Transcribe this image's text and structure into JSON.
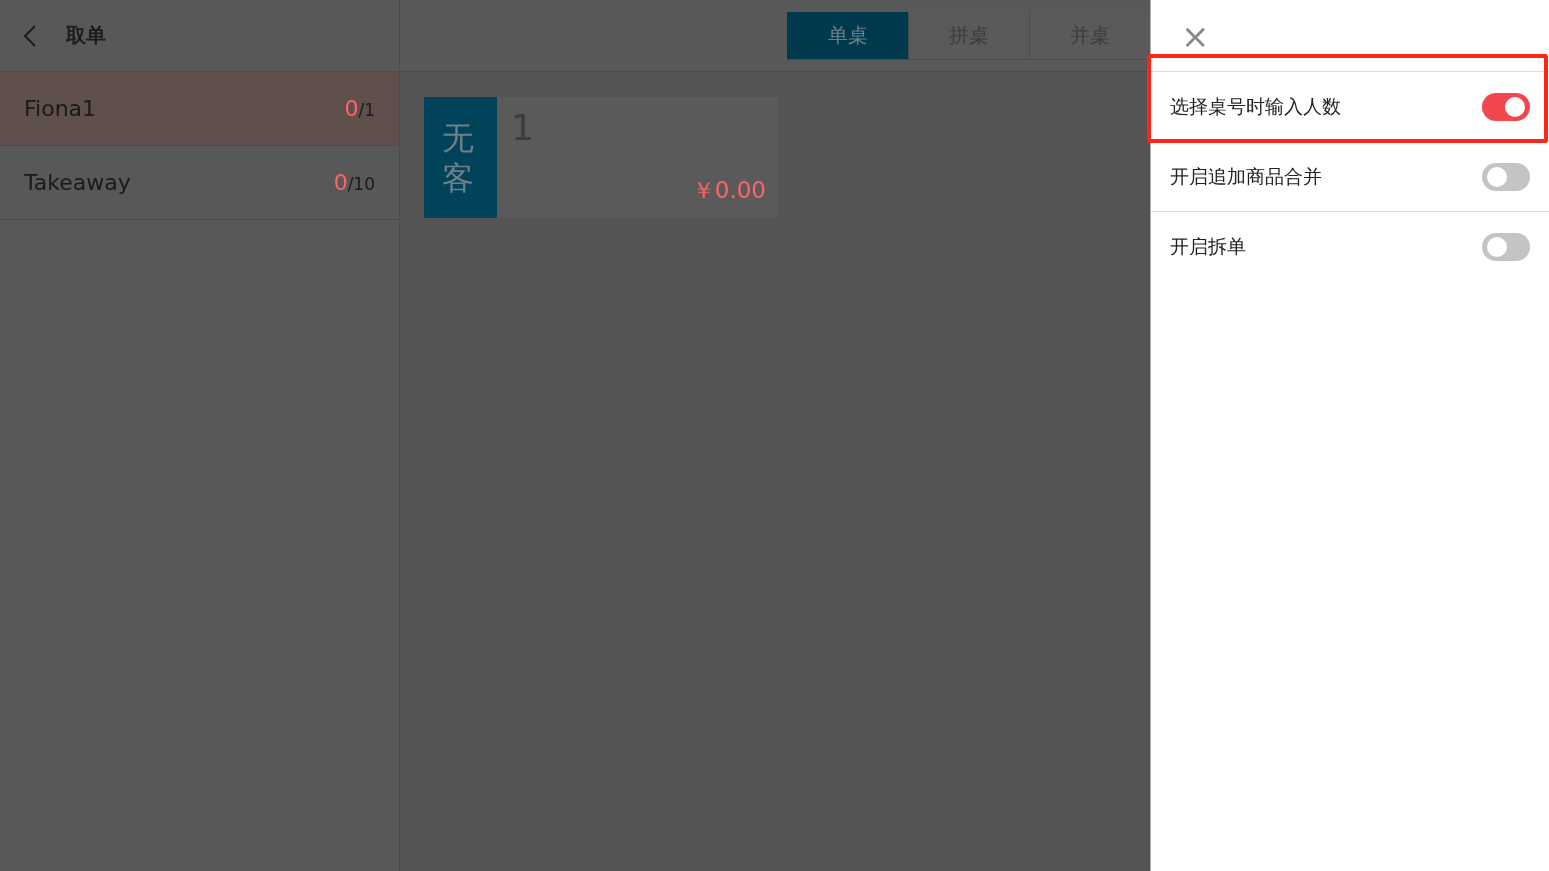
{
  "header": {
    "title": "取单"
  },
  "customers": [
    {
      "name": "Fiona1",
      "count": "0",
      "total": "/1",
      "selected": true
    },
    {
      "name": "Takeaway",
      "count": "0",
      "total": "/10",
      "selected": false
    }
  ],
  "tabs": [
    {
      "label": "单桌",
      "selected": true
    },
    {
      "label": "拼桌",
      "selected": false
    },
    {
      "label": "并桌",
      "selected": false
    }
  ],
  "tables": [
    {
      "status": "无客",
      "number": "1",
      "amount": "￥0.00"
    }
  ],
  "settings_panel": {
    "close": "×",
    "settings": [
      {
        "label": "选择桌号时输入人数",
        "on": true,
        "highlighted": true
      },
      {
        "label": "开启追加商品合并",
        "on": false,
        "highlighted": false
      },
      {
        "label": "开启拆单",
        "on": false,
        "highlighted": false
      }
    ]
  }
}
